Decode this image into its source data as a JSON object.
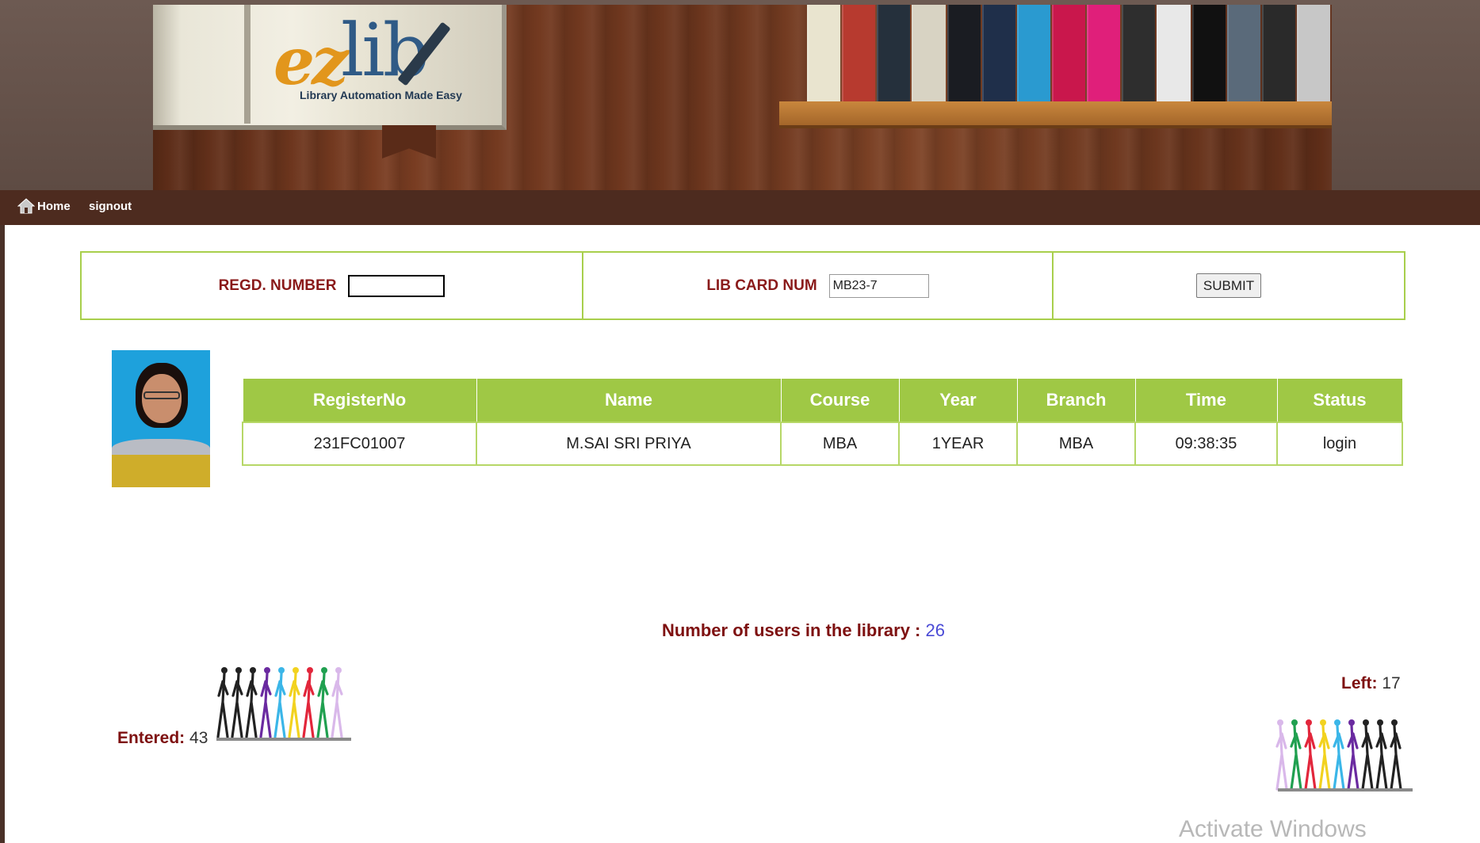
{
  "header": {
    "logo_main": "ez",
    "logo_secondary": "lib",
    "logo_tagline": "Library Automation Made Easy",
    "book_colors": [
      "#e9e4cf",
      "#b73a2f",
      "#25303c",
      "#d8d3c3",
      "#1a1c22",
      "#1f2f4a",
      "#2a9ad0",
      "#c9174c",
      "#e01f7a",
      "#2e2e2e",
      "#e8e8e8",
      "#111111",
      "#5a6a7a",
      "#2a2a2a",
      "#c7c7c7"
    ]
  },
  "nav": {
    "home_label": "Home",
    "signout_label": "signout"
  },
  "form": {
    "regd_label": "REGD. NUMBER",
    "regd_value": "",
    "card_label": "LIB CARD NUM",
    "card_value": "MB23-7",
    "submit_label": "SUBMIT"
  },
  "table": {
    "headers": [
      "RegisterNo",
      "Name",
      "Course",
      "Year",
      "Branch",
      "Time",
      "Status"
    ],
    "row": [
      "231FC01007",
      "M.SAI SRI PRIYA",
      "MBA",
      "1YEAR",
      "MBA",
      "09:38:35",
      "login"
    ]
  },
  "stats": {
    "users_label": "Number of users in the library :",
    "users_count": "26",
    "entered_label": "Entered:",
    "entered_count": "43",
    "left_label": "Left:",
    "left_count": "17"
  },
  "figure_colors_in": [
    "#222222",
    "#222222",
    "#222222",
    "#6a2aa0",
    "#3bb6e8",
    "#f2d21f",
    "#e2263b",
    "#20a050",
    "#d9b8ea"
  ],
  "figure_colors_out": [
    "#d9b8ea",
    "#20a050",
    "#e2263b",
    "#f2d21f",
    "#3bb6e8",
    "#6a2aa0",
    "#222222",
    "#222222",
    "#222222"
  ],
  "watermark": "Activate Windows"
}
